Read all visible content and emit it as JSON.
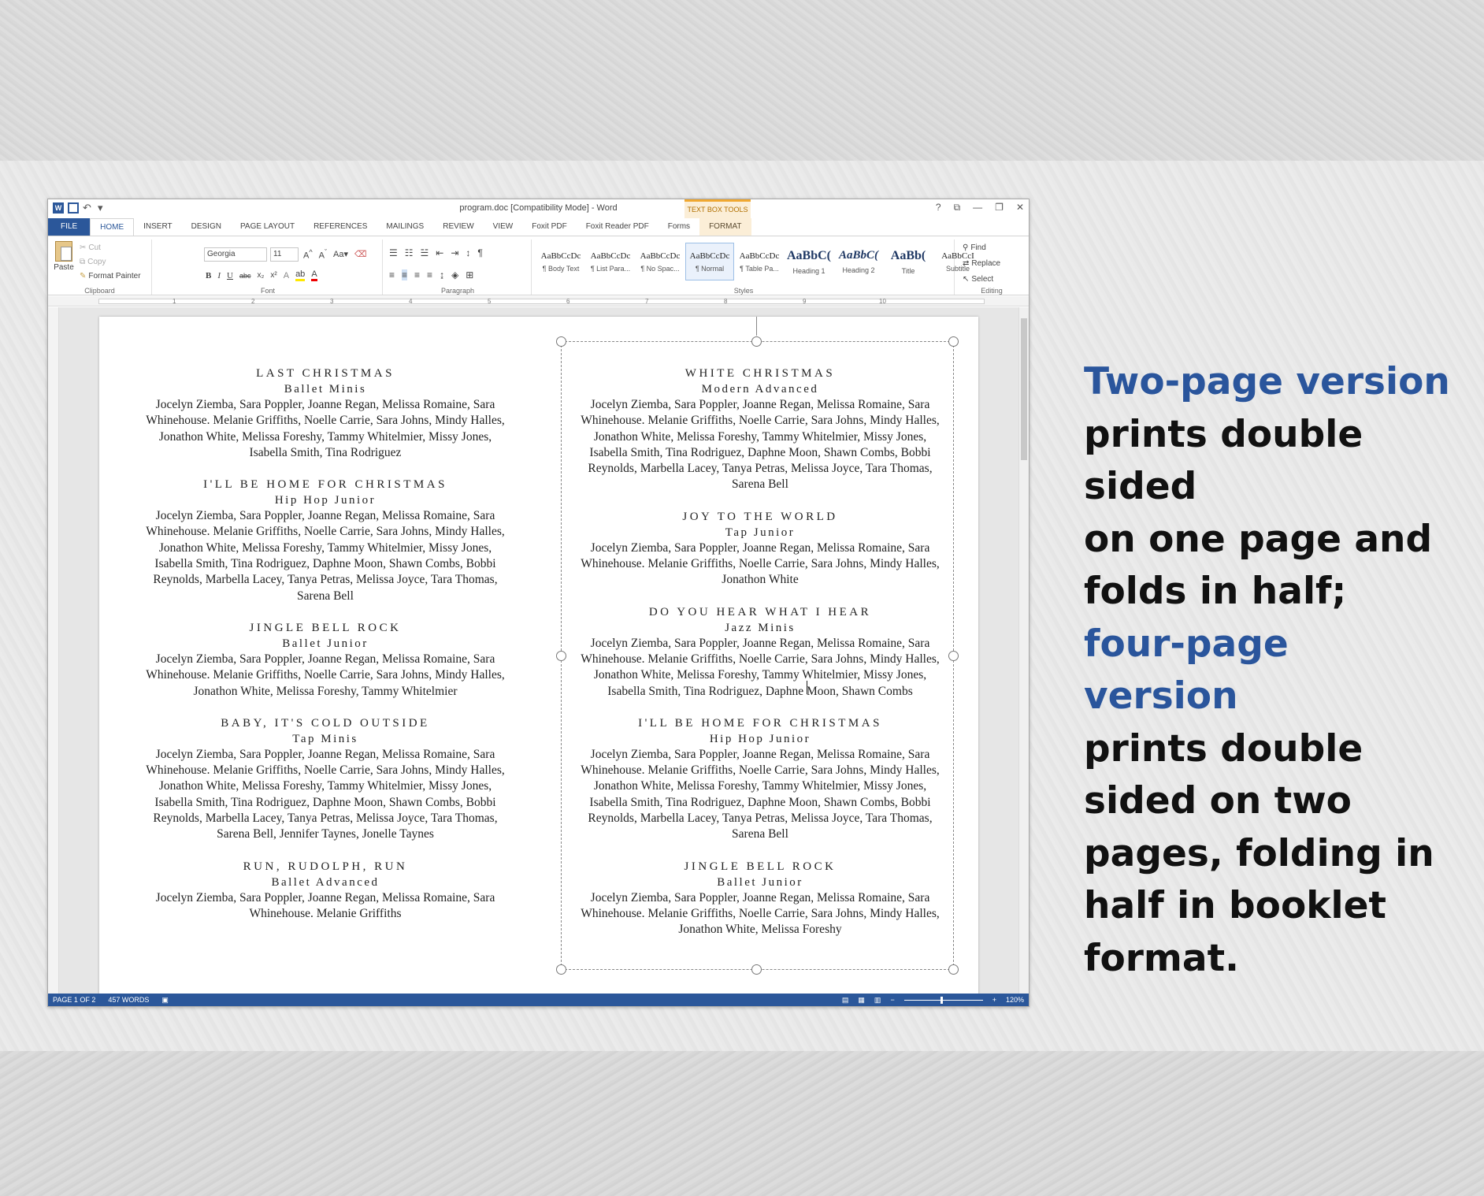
{
  "window": {
    "title": "program.doc [Compatibility Mode] - Word",
    "contextual_group": "TEXT BOX TOOLS",
    "controls": [
      "?",
      "⧉",
      "—",
      "❐",
      "✕"
    ]
  },
  "tabs": [
    "FILE",
    "HOME",
    "INSERT",
    "DESIGN",
    "PAGE LAYOUT",
    "REFERENCES",
    "MAILINGS",
    "REVIEW",
    "VIEW",
    "Foxit PDF",
    "Foxit Reader PDF",
    "Forms",
    "FORMAT"
  ],
  "ribbon": {
    "clipboard": {
      "paste": "Paste",
      "cut": "Cut",
      "copy": "Copy",
      "format_painter": "Format Painter",
      "label": "Clipboard"
    },
    "font": {
      "name": "Georgia",
      "size": "11",
      "label": "Font"
    },
    "paragraph": {
      "label": "Paragraph"
    },
    "styles": {
      "label": "Styles",
      "items": [
        {
          "preview": "AaBbCcDc",
          "name": "¶ Body Text"
        },
        {
          "preview": "AaBbCcDc",
          "name": "¶ List Para..."
        },
        {
          "preview": "AaBbCcDc",
          "name": "¶ No Spac..."
        },
        {
          "preview": "AaBbCcDc",
          "name": "¶ Normal"
        },
        {
          "preview": "AaBbCcDc",
          "name": "¶ Table Pa..."
        },
        {
          "preview": "AaBbC(",
          "name": "Heading 1"
        },
        {
          "preview": "AaBbC(",
          "name": "Heading 2"
        },
        {
          "preview": "AaBb(",
          "name": "Title"
        },
        {
          "preview": "AaBbCcI",
          "name": "Subtitle"
        }
      ]
    },
    "editing": {
      "find": "Find",
      "replace": "Replace",
      "select": "Select",
      "label": "Editing"
    }
  },
  "ruler": [
    "1",
    "2",
    "3",
    "4",
    "5",
    "6",
    "7",
    "8",
    "9",
    "10"
  ],
  "document": {
    "left": [
      {
        "title": "LAST CHRISTMAS",
        "sub": "Ballet Minis",
        "names": "Jocelyn Ziemba, Sara Poppler, Joanne Regan, Melissa Romaine, Sara Whinehouse. Melanie Griffiths, Noelle Carrie, Sara Johns, Mindy Halles, Jonathon White, Melissa Foreshy, Tammy Whitelmier, Missy Jones, Isabella Smith, Tina Rodriguez"
      },
      {
        "title": "I'LL BE HOME FOR CHRISTMAS",
        "sub": "Hip Hop Junior",
        "names": "Jocelyn Ziemba, Sara Poppler, Joanne Regan, Melissa Romaine, Sara Whinehouse. Melanie Griffiths, Noelle Carrie, Sara Johns, Mindy Halles, Jonathon White, Melissa Foreshy, Tammy Whitelmier, Missy Jones, Isabella Smith, Tina Rodriguez, Daphne Moon, Shawn Combs, Bobbi Reynolds, Marbella Lacey, Tanya Petras, Melissa Joyce, Tara Thomas, Sarena Bell"
      },
      {
        "title": "JINGLE BELL ROCK",
        "sub": "Ballet Junior",
        "names": "Jocelyn Ziemba, Sara Poppler, Joanne Regan, Melissa Romaine, Sara Whinehouse. Melanie Griffiths, Noelle Carrie, Sara Johns, Mindy Halles, Jonathon White, Melissa Foreshy, Tammy Whitelmier"
      },
      {
        "title": "BABY, IT'S COLD OUTSIDE",
        "sub": "Tap Minis",
        "names": "Jocelyn Ziemba, Sara Poppler, Joanne Regan, Melissa Romaine, Sara Whinehouse. Melanie Griffiths, Noelle Carrie, Sara Johns, Mindy Halles, Jonathon White, Melissa Foreshy, Tammy Whitelmier, Missy Jones, Isabella Smith, Tina Rodriguez, Daphne Moon, Shawn Combs, Bobbi Reynolds, Marbella Lacey, Tanya Petras, Melissa Joyce, Tara Thomas, Sarena Bell, Jennifer Taynes, Jonelle Taynes"
      },
      {
        "title": "RUN, RUDOLPH, RUN",
        "sub": "Ballet Advanced",
        "names": "Jocelyn Ziemba, Sara Poppler, Joanne Regan, Melissa Romaine, Sara Whinehouse. Melanie Griffiths"
      }
    ],
    "right": [
      {
        "title": "WHITE CHRISTMAS",
        "sub": "Modern Advanced",
        "names": "Jocelyn Ziemba, Sara Poppler, Joanne Regan, Melissa Romaine, Sara Whinehouse. Melanie Griffiths, Noelle Carrie, Sara Johns, Mindy Halles, Jonathon White, Melissa Foreshy, Tammy Whitelmier, Missy Jones, Isabella Smith, Tina Rodriguez, Daphne Moon, Shawn Combs, Bobbi Reynolds, Marbella Lacey, Tanya Petras, Melissa Joyce, Tara Thomas, Sarena Bell"
      },
      {
        "title": "JOY TO THE WORLD",
        "sub": "Tap Junior",
        "names": "Jocelyn Ziemba, Sara Poppler, Joanne Regan, Melissa Romaine, Sara Whinehouse. Melanie Griffiths, Noelle Carrie, Sara Johns, Mindy Halles, Jonathon White"
      },
      {
        "title": "DO YOU HEAR WHAT I HEAR",
        "sub": "Jazz Minis",
        "names": "Jocelyn Ziemba, Sara Poppler, Joanne Regan, Melissa Romaine, Sara Whinehouse. Melanie Griffiths, Noelle Carrie, Sara Johns, Mindy Halles, Jonathon White, Melissa Foreshy, Tammy Whitelmier, Missy Jones, Isabella Smith, Tina Rodriguez, Daphne Moon, Shawn Combs"
      },
      {
        "title": "I'LL BE HOME FOR CHRISTMAS",
        "sub": "Hip Hop Junior",
        "names": "Jocelyn Ziemba, Sara Poppler, Joanne Regan, Melissa Romaine, Sara Whinehouse. Melanie Griffiths, Noelle Carrie, Sara Johns, Mindy Halles, Jonathon White, Melissa Foreshy, Tammy Whitelmier, Missy Jones, Isabella Smith, Tina Rodriguez, Daphne Moon, Shawn Combs, Bobbi Reynolds, Marbella Lacey, Tanya Petras, Melissa Joyce, Tara Thomas, Sarena Bell"
      },
      {
        "title": "JINGLE BELL ROCK",
        "sub": "Ballet Junior",
        "names": "Jocelyn Ziemba, Sara Poppler, Joanne Regan, Melissa Romaine, Sara Whinehouse. Melanie Griffiths, Noelle Carrie, Sara Johns, Mindy Halles, Jonathon White, Melissa Foreshy"
      }
    ]
  },
  "status": {
    "page": "PAGE 1 OF 2",
    "words": "457 WORDS",
    "zoom": "120%",
    "zoom_fraction": 0.46
  },
  "callout": {
    "lines": [
      {
        "text": "Two-page version",
        "accent": true
      },
      {
        "text": "prints double sided",
        "accent": false
      },
      {
        "text": "on one page and",
        "accent": false
      },
      {
        "text": "folds in half;",
        "accent": false
      },
      {
        "text": "four-page",
        "accent": true
      },
      {
        "text": "version",
        "accent": true
      },
      {
        "text": "prints double",
        "accent": false
      },
      {
        "text": "sided on two",
        "accent": false
      },
      {
        "text": "pages, folding in",
        "accent": false
      },
      {
        "text": "half in booklet",
        "accent": false
      },
      {
        "text": "format.",
        "accent": false
      }
    ]
  },
  "colors": {
    "word_blue": "#2b579a",
    "accent_blue": "#2a559c",
    "tab_orange": "#f0a830"
  }
}
